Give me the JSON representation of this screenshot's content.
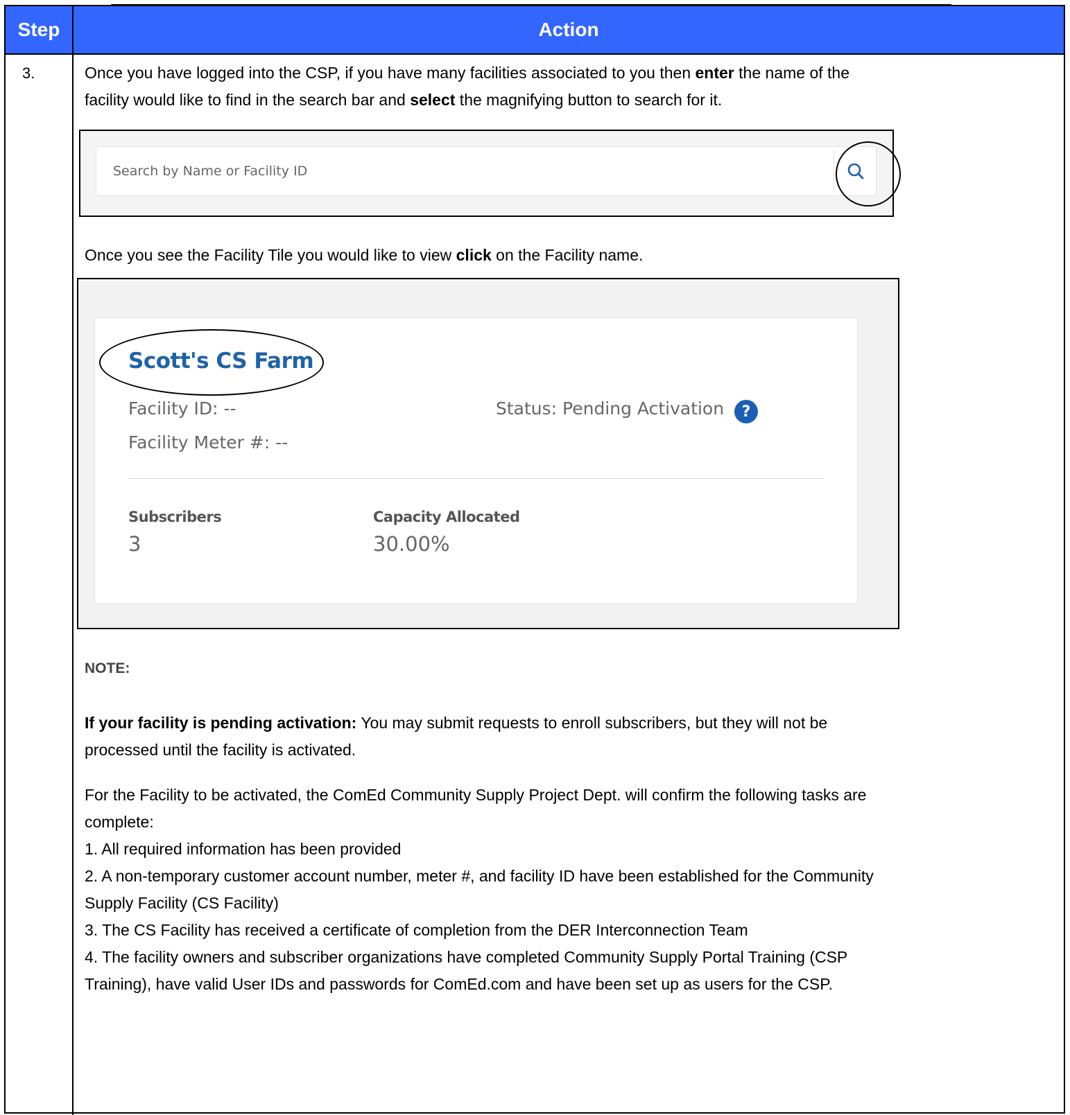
{
  "table": {
    "header_step": "Step",
    "header_action": "Action",
    "step_number": "3."
  },
  "intro": {
    "text_1": "Once you have logged into the CSP, if you have many facilities associated to you then ",
    "bold_1": "enter",
    "text_2": " the name of the facility would like to find in the search bar and ",
    "bold_2": "select",
    "text_3": " the magnifying button to search for it."
  },
  "search": {
    "placeholder": "Search by Name or Facility ID",
    "button_icon": "search-icon"
  },
  "tile_instruction": {
    "text_1": "Once you see the Facility Tile you would like to view ",
    "bold": "click",
    "text_2": " on the Facility name."
  },
  "facility_tile": {
    "name": "Scott's CS Farm",
    "facility_id": "Facility ID: --",
    "meter": "Facility Meter #: --",
    "status": "Status: Pending Activation",
    "help_icon": "?",
    "subscribers_label": "Subscribers",
    "subscribers_value": "3",
    "capacity_label": "Capacity Allocated",
    "capacity_value": "30.00%",
    "colors": {
      "link": "#1e63a8",
      "help": "#1a5fb4"
    }
  },
  "note": {
    "title": "NOTE:",
    "pending_bold": "If your facility is pending activation:",
    "pending_text_1": " You may submit requests to enroll subscribers, but they will not be",
    "pending_text_2": "processed until the facility is activated.",
    "activation_line_1": "For the Facility to be activated, the ComEd Community Supply Project Dept. will confirm the following tasks are",
    "activation_line_2": "complete:",
    "item_1": "1. All required information has been provided",
    "item_2_line_1": "2. A non-temporary customer account number, meter #, and facility ID have been established for the Community",
    "item_2_line_2": "Supply Facility (CS Facility)",
    "item_3": "3. The CS Facility has received a certificate of completion from the DER Interconnection Team",
    "item_4_line_1": "4. The facility owners and subscriber organizations have completed Community Supply Portal Training (CSP",
    "item_4_line_2": "Training), have valid User IDs and passwords for ComEd.com and have been set up as users for the CSP."
  },
  "colors": {
    "header_bg": "#3366ff",
    "header_text": "#ffffff"
  }
}
